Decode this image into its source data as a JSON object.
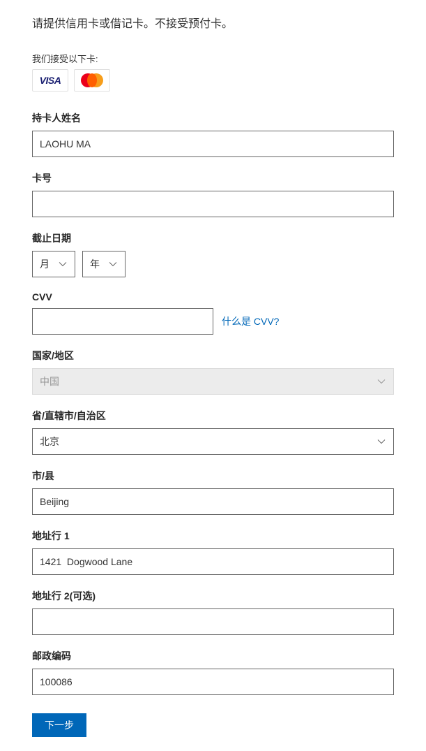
{
  "instructions": "请提供信用卡或借记卡。不接受预付卡。",
  "accepted_cards_label": "我们接受以下卡:",
  "cardholder": {
    "label": "持卡人姓名",
    "value": "LAOHU MA"
  },
  "card_number": {
    "label": "卡号",
    "value": ""
  },
  "expiry": {
    "label": "截止日期",
    "month_placeholder": "月",
    "year_placeholder": "年"
  },
  "cvv": {
    "label": "CVV",
    "value": "",
    "help": "什么是 CVV?"
  },
  "country": {
    "label": "国家/地区",
    "value": "中国"
  },
  "province": {
    "label": "省/直辖市/自治区",
    "value": "北京"
  },
  "city": {
    "label": "市/县",
    "value": "Beijing"
  },
  "address1": {
    "label": "地址行 1",
    "value": "1421  Dogwood Lane"
  },
  "address2": {
    "label": "地址行 2(可选)",
    "value": ""
  },
  "postal": {
    "label": "邮政编码",
    "value": "100086"
  },
  "next_button": "下一步"
}
